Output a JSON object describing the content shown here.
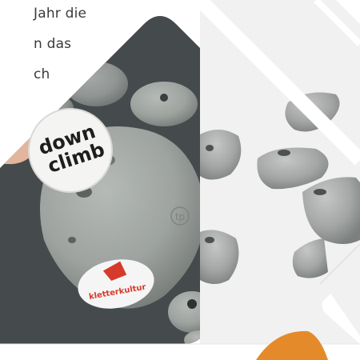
{
  "text_fragments": [
    "Jahr die",
    "n das",
    "ch"
  ],
  "badges": {
    "down_climb": [
      "down",
      "climb"
    ],
    "kletterkultur": "kletterkultur"
  },
  "logo_mark": "tp",
  "colors": {
    "background": "#ffffff",
    "wall": "#454a4d",
    "hold": "#9ea3a0",
    "hold_shadow": "#6f7472",
    "badge_red": "#d63a2a",
    "orange_accent": "#e58a2b"
  }
}
